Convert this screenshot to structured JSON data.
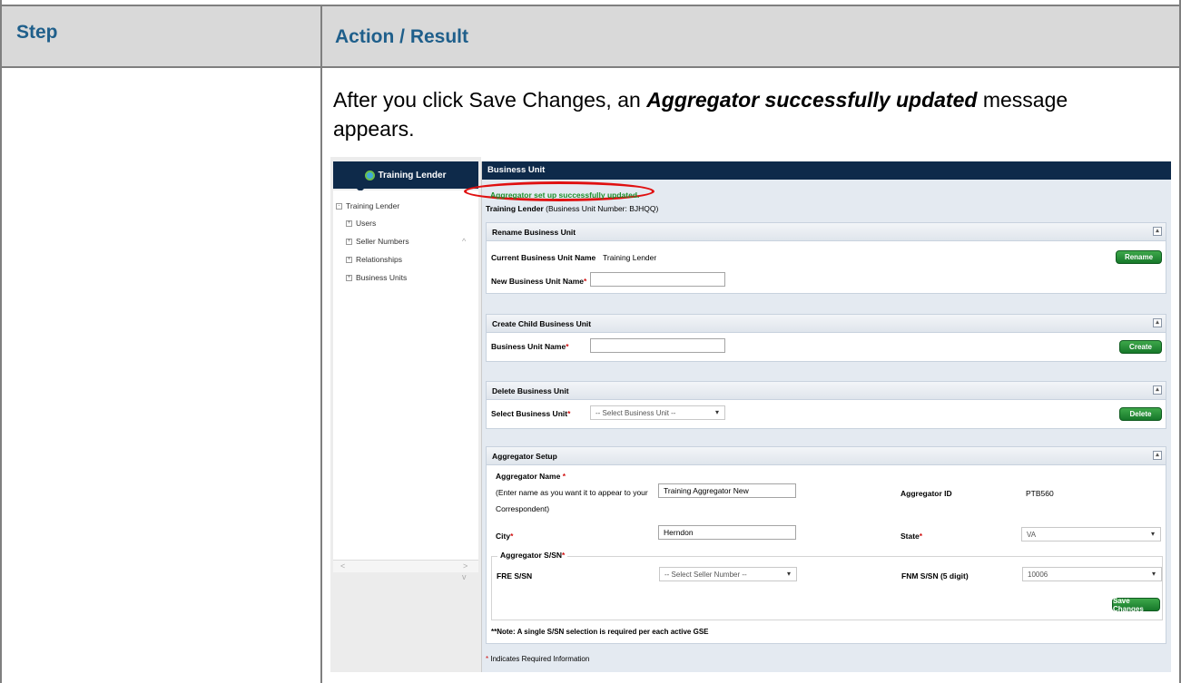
{
  "doc": {
    "header_step": "Step",
    "header_action": "Action / Result",
    "intro_pre": "After you click Save Changes, an ",
    "intro_bold": "Aggregator successfully updated",
    "intro_post": " message appears."
  },
  "nav": {
    "title": "Training Lender",
    "root": "Training Lender",
    "items": [
      "Users",
      "Seller Numbers",
      "Relationships",
      "Business Units"
    ],
    "expand_symbol": "+",
    "collapse_symbol": "-",
    "scroll_up": "^",
    "scroll_down": "v",
    "scroll_left": "<",
    "scroll_right": ">"
  },
  "main": {
    "title": "Business Unit",
    "success_message": "Aggregator set up successfully updated.",
    "bu_name": "Training Lender",
    "bu_number": " (Business Unit Number: BJHQQ)"
  },
  "rename": {
    "title": "Rename Business Unit",
    "current_label": "Current Business Unit Name",
    "current_value": "Training Lender",
    "new_label": "New Business Unit Name",
    "new_value": "",
    "button": "Rename"
  },
  "create": {
    "title": "Create Child Business Unit",
    "name_label": "Business Unit Name",
    "name_value": "",
    "button": "Create"
  },
  "delete": {
    "title": "Delete Business Unit",
    "select_label": "Select Business Unit",
    "select_value": "-- Select Business Unit --",
    "button": "Delete"
  },
  "aggregator": {
    "title": "Aggregator Setup",
    "name_label": "Aggregator Name",
    "name_hint_1": "(Enter name as you want it to appear to your",
    "name_hint_2": "Correspondent)",
    "name_value": "Training Aggregator New",
    "id_label": "Aggregator ID",
    "id_value": "PTB560",
    "city_label": "City",
    "city_value": "Herndon",
    "state_label": "State",
    "state_value": "VA",
    "ssn_legend": "Aggregator S/SN",
    "fre_label": "FRE S/SN",
    "fre_value": "-- Select Seller Number --",
    "fnm_label": "FNM S/SN (5 digit)",
    "fnm_value": "10006",
    "save_button": "Save Changes",
    "note": "**Note: A single S/SN selection is required per each active GSE",
    "required_info": "Indicates Required Information"
  },
  "common": {
    "required_mark": "*",
    "collapse_symbol": "▴",
    "caret": "▾"
  }
}
